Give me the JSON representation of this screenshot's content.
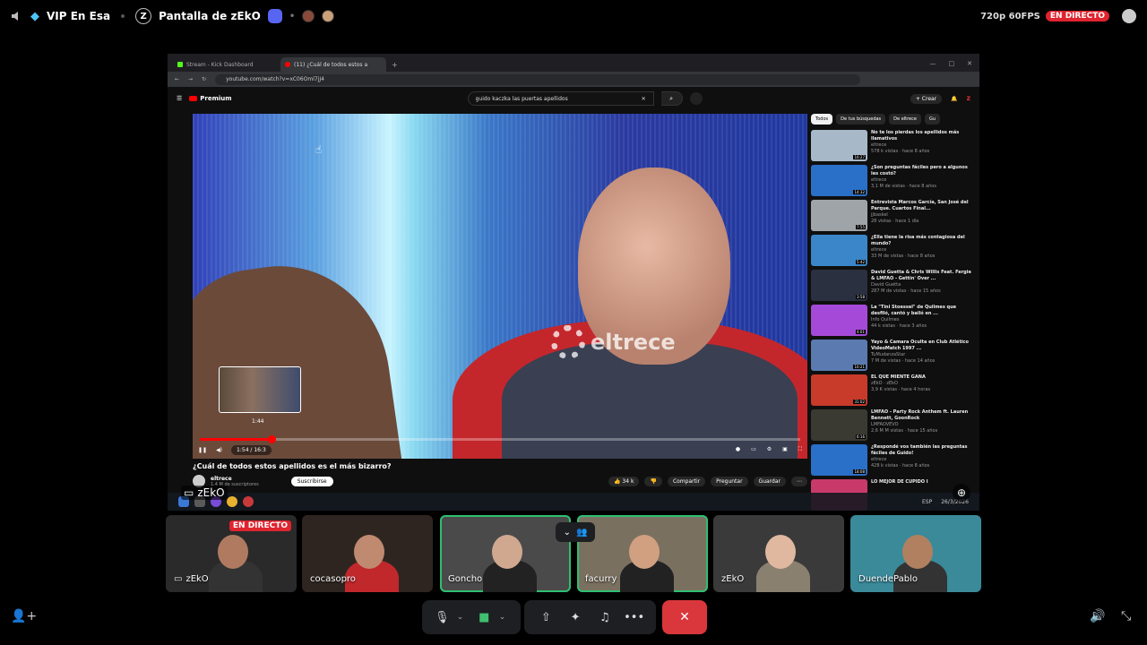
{
  "topbar": {
    "channel": "VIP En Esa",
    "stream_title": "Pantalla de zEkO",
    "server_initial": "Z",
    "quality": "720p 60FPS",
    "live_label": "EN DIRECTO"
  },
  "browser": {
    "tabs": [
      {
        "label": "Stream - Kick Dashboard",
        "icon": "kick-icon"
      },
      {
        "label": "(11) ¿Cuál de todos estos a",
        "icon": "youtube-icon"
      }
    ],
    "url": "youtube.com/watch?v=xC06Oml7jJ4"
  },
  "youtube": {
    "logo": "Premium",
    "search_query": "guido kaczka las puertas apellidos",
    "create_label": "+ Crear",
    "video_title": "¿Cuál de todos estos apellidos es el más bizarro?",
    "channel_name": "eltrece",
    "channel_subs": "1,4 M de suscriptores",
    "subscribe_label": "Suscribirse",
    "likes": "34 k",
    "share_label": "Compartir",
    "ask_label": "Preguntar",
    "save_label": "Guardar",
    "watermark": "eltrece",
    "preview_time": "1:44",
    "time_display": "1:54 / 16:3",
    "progress_fraction": 0.12,
    "chips": [
      "Todos",
      "De tus búsquedas",
      "De eltrece",
      "Gu"
    ],
    "sidebar": [
      {
        "title": "No te los pierdas los apellidos más llamativos",
        "channel": "eltrece",
        "meta": "578 k vistas · hace 8 años",
        "duration": "16:27",
        "color": "#a7b8c8"
      },
      {
        "title": "¿Son preguntas fáciles pero a algunos les costó?",
        "channel": "eltrece",
        "meta": "3,1 M de vistas · hace 8 años",
        "duration": "14:32",
        "color": "#2a6fc8"
      },
      {
        "title": "Entrevista Marcos García, San José del Parque. Cuartos Final...",
        "channel": "jjbaskel",
        "meta": "28 vistas · hace 1 día",
        "duration": "7:55",
        "color": "#9fa4a8"
      },
      {
        "title": "¿Ella tiene la risa más contagiosa del mundo?",
        "channel": "eltrece",
        "meta": "33 M de vistas · hace 8 años",
        "duration": "5:42",
        "color": "#3a86c8"
      },
      {
        "title": "David Guetta & Chris Willis Feat. Fergie & LMFAO - Gettin' Over ...",
        "channel": "David Guetta",
        "meta": "287 M de vistas · hace 15 años",
        "duration": "3:58",
        "color": "#2b3040"
      },
      {
        "title": "La \"Tini Stoessel\" de Quilmes que desfiló, cantó y bailó en ...",
        "channel": "Info Quilmes",
        "meta": "44 k vistas · hace 3 años",
        "duration": "4:01",
        "color": "#a54ad8"
      },
      {
        "title": "Yayo & Camara Oculta en Club Atlético VideoMatch 1997 ...",
        "channel": "TuMudanzaStar",
        "meta": "7 M de vistas · hace 14 años",
        "duration": "10:21",
        "color": "#5a7ab0"
      },
      {
        "title": "EL QUE MIENTE GANA",
        "channel": "zEkO · zEkO",
        "meta": "3,9 K vistas · hace 4 horas",
        "duration": "31:02",
        "color": "#c83a2a"
      },
      {
        "title": "LMFAO - Party Rock Anthem ft. Lauren Bennett, GoonRock",
        "channel": "LMFAOVEVO",
        "meta": "2,6 M M vistas · hace 15 años",
        "duration": "6:16",
        "color": "#3a3a32"
      },
      {
        "title": "¿Respondé vos también las preguntas fáciles de Guido!",
        "channel": "eltrece",
        "meta": "428 k vistas · hace 8 años",
        "duration": "18:08",
        "color": "#2a6fc8"
      },
      {
        "title": "LO MEJOR DE CUPIDO I",
        "channel": "",
        "meta": "",
        "duration": "",
        "color": "#c83a6a"
      }
    ]
  },
  "taskbar": {
    "lang": "ESP",
    "date": "26/3/2026"
  },
  "screen_owner": "zEkO",
  "participants": [
    {
      "name": "zEkO",
      "live": "EN DIRECTO",
      "bg": "#2a2a2a",
      "skin": "#b07a60",
      "shirt": "#333"
    },
    {
      "name": "cocasopro",
      "bg": "#2e2520",
      "skin": "#c08a70",
      "shirt": "#c0282c"
    },
    {
      "name": "Goncho",
      "bg": "#4a4a4a",
      "skin": "#d0a890",
      "shirt": "#222"
    },
    {
      "name": "facurry",
      "bg": "#7a7060",
      "skin": "#d0a080",
      "shirt": "#222"
    },
    {
      "name": "zEkO",
      "bg": "#3a3a3a",
      "skin": "#e0b8a0",
      "shirt": "#8a8070"
    },
    {
      "name": "DuendePablo",
      "bg": "#3a8a9a",
      "skin": "#b08060",
      "shirt": "#333"
    }
  ],
  "controls": {
    "mic": "mic-icon",
    "camera": "camera-icon",
    "share": "screen-share-icon",
    "activities": "activities-icon",
    "soundboard": "soundboard-icon",
    "more": "more-icon",
    "hangup": "hangup-icon"
  }
}
